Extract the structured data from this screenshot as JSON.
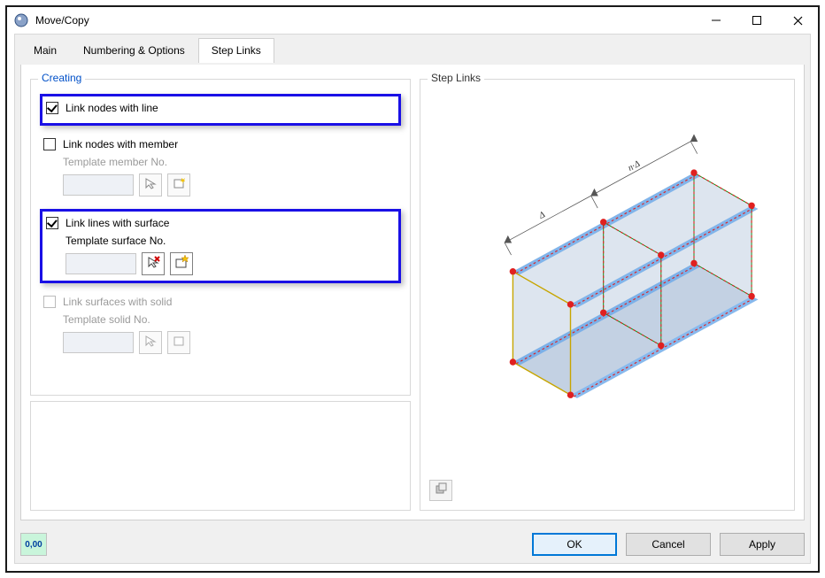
{
  "window": {
    "title": "Move/Copy"
  },
  "tabs": {
    "main": "Main",
    "numbering": "Numbering & Options",
    "steplinks": "Step Links"
  },
  "creating": {
    "title": "Creating",
    "link_nodes_line": {
      "label": "Link nodes with line",
      "checked": true
    },
    "link_nodes_member": {
      "label": "Link nodes with member",
      "checked": false,
      "template_label": "Template member No.",
      "value": ""
    },
    "link_lines_surface": {
      "label": "Link lines with surface",
      "checked": true,
      "template_label": "Template surface No.",
      "value": ""
    },
    "link_surfaces_solid": {
      "label": "Link surfaces with solid",
      "checked": false,
      "enabled": false,
      "template_label": "Template solid No.",
      "value": ""
    }
  },
  "preview": {
    "title": "Step Links"
  },
  "buttons": {
    "ok": "OK",
    "cancel": "Cancel",
    "apply": "Apply",
    "decimal": "0,00"
  },
  "icons": {
    "pick": "pick-icon",
    "new": "new-icon",
    "pick_delete": "pick-delete-icon",
    "new_star": "new-star-icon",
    "preview_tool": "preview-tool-icon"
  }
}
